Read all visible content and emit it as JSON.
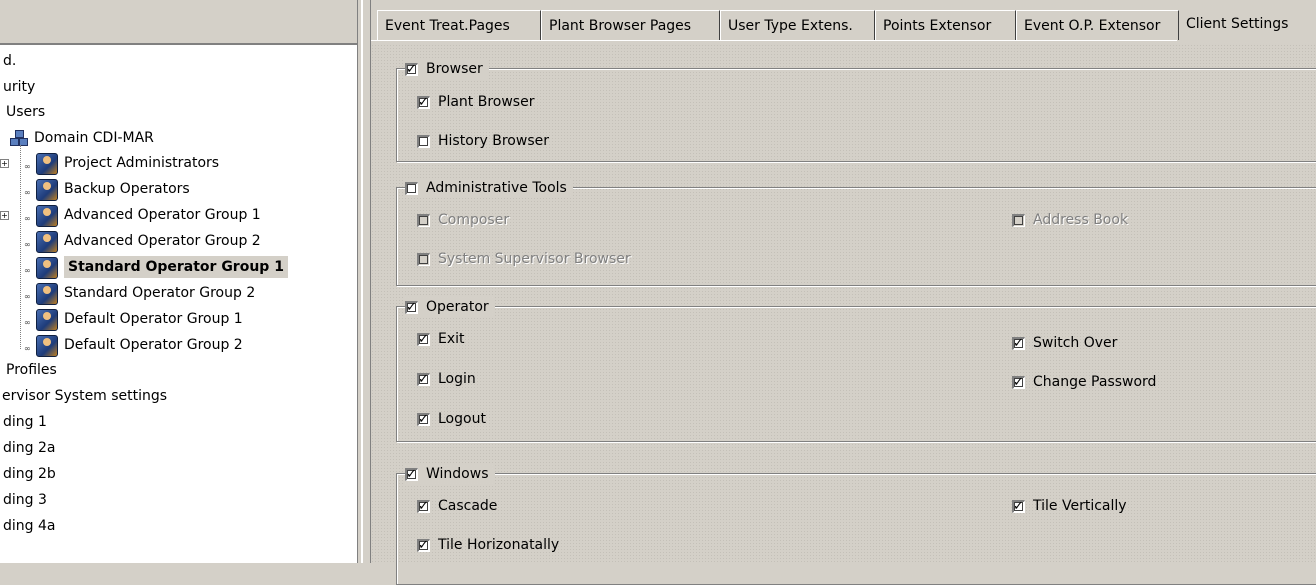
{
  "tree": {
    "items": [
      {
        "label": "d."
      },
      {
        "label": "urity"
      },
      {
        "label": "Users"
      },
      {
        "label": "Domain CDI-MAR"
      },
      {
        "label": "Project Administrators"
      },
      {
        "label": "Backup Operators"
      },
      {
        "label": "Advanced Operator Group 1"
      },
      {
        "label": "Advanced Operator Group 2"
      },
      {
        "label": "Standard Operator Group 1"
      },
      {
        "label": "Standard Operator Group 2"
      },
      {
        "label": "Default Operator Group 1"
      },
      {
        "label": "Default Operator Group 2"
      },
      {
        "label": "Profiles"
      },
      {
        "label": "ervisor System settings"
      },
      {
        "label": "ding 1"
      },
      {
        "label": "ding 2a"
      },
      {
        "label": "ding 2b"
      },
      {
        "label": "ding 3"
      },
      {
        "label": "ding 4a"
      }
    ]
  },
  "tabs": [
    {
      "label": "Event Treat.Pages"
    },
    {
      "label": "Plant Browser Pages"
    },
    {
      "label": "User Type Extens."
    },
    {
      "label": "Points Extensor"
    },
    {
      "label": "Event O.P. Extensor"
    },
    {
      "label": "Client Settings",
      "active": true
    }
  ],
  "groups": {
    "browser": {
      "label": "Browser",
      "checked": true,
      "options": [
        {
          "label": "Plant Browser",
          "checked": true
        },
        {
          "label": "History Browser",
          "checked": false
        }
      ]
    },
    "admin": {
      "label": "Administrative Tools",
      "checked": false,
      "options": [
        {
          "label": "Composer",
          "checked": false,
          "disabled": true
        },
        {
          "label": "Address Book",
          "checked": false,
          "disabled": true
        },
        {
          "label": "System Supervisor Browser",
          "checked": false,
          "disabled": true
        }
      ]
    },
    "operator": {
      "label": "Operator",
      "checked": true,
      "options": [
        {
          "label": "Exit",
          "checked": true
        },
        {
          "label": "Switch Over",
          "checked": true
        },
        {
          "label": "Login",
          "checked": true
        },
        {
          "label": "Change Password",
          "checked": true
        },
        {
          "label": "Logout",
          "checked": true
        }
      ]
    },
    "windows": {
      "label": "Windows",
      "checked": true,
      "options": [
        {
          "label": "Cascade",
          "checked": true
        },
        {
          "label": "Tile Vertically",
          "checked": true
        },
        {
          "label": "Tile Horizonatally",
          "checked": true
        }
      ]
    }
  }
}
